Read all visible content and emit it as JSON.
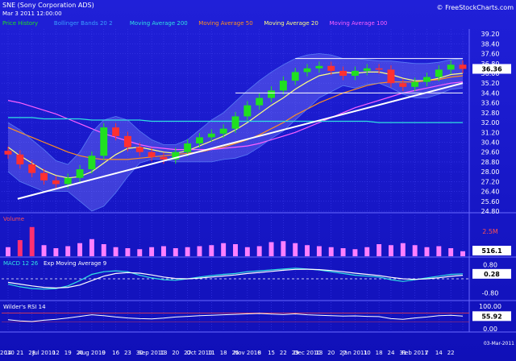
{
  "header": {
    "symbol": "SNE (Sony Corporation ADS)",
    "date": "Mar 3 2011 12:00:00",
    "brand": "© FreeStockCharts.com"
  },
  "legend": [
    {
      "label": "Price History",
      "color": "#20e020"
    },
    {
      "label": "Bollinger Bands 20 2",
      "color": "#3aa0ff"
    },
    {
      "label": "Moving Average 200",
      "color": "#30e0e0"
    },
    {
      "label": "Moving Average 50",
      "color": "#ff9020"
    },
    {
      "label": "Moving Average 20",
      "color": "#ffff80"
    },
    {
      "label": "Moving Average 100",
      "color": "#ff60ff"
    }
  ],
  "chart_data": [
    {
      "type": "line",
      "name": "price",
      "ylim": [
        24.8,
        39.6
      ],
      "yticks": [
        "39.20",
        "38.40",
        "37.60",
        "36.80",
        "36.00",
        "35.20",
        "34.40",
        "33.60",
        "32.80",
        "32.00",
        "31.20",
        "30.40",
        "29.60",
        "28.80",
        "28.00",
        "27.20",
        "26.40",
        "25.60",
        "24.80"
      ],
      "last_value": "36.36",
      "x_dates": [
        "2010-06-14",
        "2010-06-21",
        "2010-06-28",
        "2010-07-06",
        "2010-07-12",
        "2010-07-19",
        "2010-07-26",
        "2010-08-02",
        "2010-08-09",
        "2010-08-16",
        "2010-08-23",
        "2010-08-30",
        "2010-09-07",
        "2010-09-13",
        "2010-09-20",
        "2010-09-27",
        "2010-10-04",
        "2010-10-11",
        "2010-10-18",
        "2010-10-25",
        "2010-11-01",
        "2010-11-08",
        "2010-11-15",
        "2010-11-22",
        "2010-11-29",
        "2010-12-06",
        "2010-12-13",
        "2010-12-20",
        "2010-12-27",
        "2011-01-03",
        "2011-01-10",
        "2011-01-18",
        "2011-01-24",
        "2011-01-31",
        "2011-02-07",
        "2011-02-14",
        "2011-02-22",
        "2011-02-28",
        "2011-03-03"
      ],
      "series": [
        {
          "name": "Price",
          "color": "#20e020",
          "values": [
            29.4,
            28.6,
            27.9,
            27.3,
            27.0,
            27.5,
            28.2,
            29.3,
            31.6,
            30.9,
            30.0,
            29.6,
            29.2,
            29.0,
            29.6,
            30.3,
            30.8,
            31.1,
            31.5,
            32.5,
            33.4,
            34.0,
            34.6,
            35.4,
            36.1,
            36.4,
            36.6,
            36.2,
            35.8,
            36.2,
            36.4,
            36.3,
            35.2,
            34.9,
            35.3,
            35.7,
            36.3,
            36.7,
            36.36
          ]
        },
        {
          "name": "Moving Average 20",
          "color": "#ffff80",
          "values": [
            30.0,
            29.3,
            28.7,
            28.1,
            27.7,
            27.5,
            27.6,
            28.0,
            28.7,
            29.4,
            29.9,
            30.0,
            29.8,
            29.6,
            29.5,
            29.7,
            30.1,
            30.5,
            30.9,
            31.4,
            32.0,
            32.7,
            33.4,
            34.0,
            34.7,
            35.3,
            35.8,
            36.0,
            36.1,
            36.0,
            36.1,
            36.1,
            35.9,
            35.6,
            35.4,
            35.4,
            35.6,
            35.9,
            36.0
          ]
        },
        {
          "name": "Moving Average 50",
          "color": "#ff9020",
          "values": [
            31.6,
            31.2,
            30.8,
            30.4,
            30.0,
            29.6,
            29.3,
            29.1,
            29.0,
            29.0,
            29.0,
            29.1,
            29.2,
            29.3,
            29.4,
            29.5,
            29.6,
            29.8,
            30.0,
            30.3,
            30.6,
            31.0,
            31.5,
            32.0,
            32.6,
            33.1,
            33.6,
            34.0,
            34.4,
            34.7,
            35.0,
            35.2,
            35.3,
            35.3,
            35.3,
            35.4,
            35.5,
            35.7,
            35.8
          ]
        },
        {
          "name": "Moving Average 100",
          "color": "#ff60ff",
          "values": [
            33.8,
            33.6,
            33.3,
            33.0,
            32.7,
            32.3,
            31.9,
            31.5,
            31.1,
            30.8,
            30.5,
            30.2,
            30.0,
            29.9,
            29.8,
            29.8,
            29.8,
            29.8,
            29.9,
            30.0,
            30.1,
            30.3,
            30.6,
            30.9,
            31.2,
            31.6,
            32.0,
            32.4,
            32.8,
            33.2,
            33.5,
            33.8,
            34.1,
            34.4,
            34.6,
            34.8,
            35.0,
            35.2,
            35.3
          ]
        },
        {
          "name": "Moving Average 200",
          "color": "#30e0e0",
          "values": [
            32.4,
            32.4,
            32.4,
            32.3,
            32.3,
            32.3,
            32.3,
            32.2,
            32.2,
            32.2,
            32.2,
            32.2,
            32.1,
            32.1,
            32.1,
            32.1,
            32.1,
            32.1,
            32.1,
            32.1,
            32.1,
            32.1,
            32.1,
            32.1,
            32.1,
            32.1,
            32.1,
            32.1,
            32.1,
            32.1,
            32.1,
            32.0,
            32.0,
            32.0,
            32.0,
            32.0,
            32.0,
            32.0,
            32.0
          ]
        },
        {
          "name": "Bollinger Upper",
          "color": "#6a9aff",
          "values": [
            32.0,
            31.4,
            30.6,
            29.8,
            28.9,
            28.6,
            29.6,
            31.2,
            32.2,
            32.5,
            32.2,
            31.3,
            30.6,
            30.2,
            30.2,
            30.6,
            31.4,
            32.2,
            32.8,
            33.7,
            34.6,
            35.4,
            36.1,
            36.7,
            37.2,
            37.5,
            37.6,
            37.5,
            37.2,
            37.2,
            37.1,
            37.0,
            37.0,
            36.9,
            36.8,
            36.8,
            36.9,
            37.1,
            37.2
          ]
        },
        {
          "name": "Bollinger Lower",
          "color": "#6a9aff",
          "values": [
            28.0,
            27.2,
            26.8,
            26.4,
            26.4,
            26.4,
            25.6,
            24.8,
            25.2,
            26.3,
            27.6,
            28.7,
            29.0,
            29.0,
            28.8,
            28.8,
            28.8,
            28.8,
            29.0,
            29.1,
            29.4,
            30.0,
            30.7,
            31.3,
            32.2,
            33.1,
            34.0,
            34.5,
            35.0,
            34.8,
            35.1,
            35.2,
            34.8,
            34.3,
            34.0,
            34.0,
            34.3,
            34.7,
            34.8
          ]
        }
      ],
      "annotations": [
        "upward trend line",
        "horizontal resistance line",
        "horizontal support line"
      ]
    },
    {
      "type": "bar",
      "name": "Volume",
      "title": "Volume",
      "yticks": [
        "2.5M"
      ],
      "last_value": "516.1",
      "values": [
        0.9,
        1.6,
        2.9,
        1.1,
        0.8,
        1.0,
        1.3,
        1.7,
        1.2,
        0.9,
        0.8,
        0.7,
        0.9,
        1.0,
        0.8,
        0.9,
        1.0,
        1.1,
        1.3,
        1.2,
        0.9,
        1.0,
        1.4,
        1.5,
        1.3,
        1.1,
        1.0,
        0.9,
        0.8,
        0.7,
        0.9,
        1.2,
        1.1,
        1.3,
        1.1,
        0.9,
        1.0,
        0.8,
        0.5
      ]
    },
    {
      "type": "line",
      "name": "MACD",
      "title": "MACD 12 26",
      "subtitle": "Exp Moving Average 9",
      "ylim": [
        -1.0,
        1.0
      ],
      "yticks": [
        "0.80",
        "-0.80"
      ],
      "last_value": "0.28",
      "series": [
        {
          "name": "MACD 12 26",
          "color": "#30e0e0",
          "values": [
            -0.3,
            -0.45,
            -0.55,
            -0.58,
            -0.55,
            -0.4,
            -0.1,
            0.25,
            0.4,
            0.45,
            0.4,
            0.2,
            0.05,
            -0.05,
            -0.08,
            0.0,
            0.1,
            0.18,
            0.25,
            0.3,
            0.4,
            0.45,
            0.5,
            0.55,
            0.6,
            0.55,
            0.5,
            0.4,
            0.3,
            0.2,
            0.15,
            0.1,
            -0.05,
            -0.15,
            -0.05,
            0.05,
            0.15,
            0.25,
            0.28
          ]
        },
        {
          "name": "Exp Moving Average 9",
          "color": "#ffffff",
          "values": [
            -0.2,
            -0.3,
            -0.4,
            -0.48,
            -0.52,
            -0.48,
            -0.35,
            -0.1,
            0.15,
            0.3,
            0.35,
            0.32,
            0.22,
            0.1,
            0.02,
            0.0,
            0.04,
            0.1,
            0.16,
            0.22,
            0.3,
            0.36,
            0.42,
            0.48,
            0.53,
            0.54,
            0.52,
            0.47,
            0.4,
            0.32,
            0.25,
            0.18,
            0.08,
            0.0,
            -0.03,
            0.0,
            0.06,
            0.14,
            0.2
          ]
        }
      ]
    },
    {
      "type": "line",
      "name": "RSI",
      "title": "Wilder's RSI 14",
      "ylim": [
        0,
        100
      ],
      "yticks": [
        "100.00",
        "0.00"
      ],
      "last_value": "55.92",
      "series": [
        {
          "name": "Wilder's RSI 14",
          "color": "#ffffff",
          "values": [
            40,
            35,
            32,
            38,
            42,
            48,
            55,
            62,
            58,
            52,
            48,
            45,
            44,
            47,
            52,
            55,
            58,
            60,
            62,
            64,
            66,
            68,
            65,
            63,
            66,
            62,
            60,
            58,
            56,
            57,
            55,
            54,
            45,
            42,
            48,
            52,
            58,
            60,
            55.92
          ]
        }
      ]
    }
  ],
  "x_axis": {
    "labels": [
      {
        "t": "2010",
        "i": 0
      },
      {
        "t": "14",
        "i": 0
      },
      {
        "t": "21",
        "i": 1
      },
      {
        "t": "28",
        "i": 2
      },
      {
        "t": "Jul 2010",
        "i": 3
      },
      {
        "t": "12",
        "i": 4
      },
      {
        "t": "19",
        "i": 5
      },
      {
        "t": "26",
        "i": 6
      },
      {
        "t": "Aug 2010",
        "i": 7
      },
      {
        "t": "9",
        "i": 8
      },
      {
        "t": "16",
        "i": 9
      },
      {
        "t": "23",
        "i": 10
      },
      {
        "t": "30",
        "i": 11
      },
      {
        "t": "Sep 2010",
        "i": 12
      },
      {
        "t": "13",
        "i": 13
      },
      {
        "t": "20",
        "i": 14
      },
      {
        "t": "27",
        "i": 15
      },
      {
        "t": "Oct 2010",
        "i": 16
      },
      {
        "t": "11",
        "i": 17
      },
      {
        "t": "18",
        "i": 18
      },
      {
        "t": "25",
        "i": 19
      },
      {
        "t": "Nov 2010",
        "i": 20
      },
      {
        "t": "8",
        "i": 21
      },
      {
        "t": "15",
        "i": 22
      },
      {
        "t": "22",
        "i": 23
      },
      {
        "t": "29",
        "i": 24
      },
      {
        "t": "Dec 2010",
        "i": 25
      },
      {
        "t": "13",
        "i": 26
      },
      {
        "t": "20",
        "i": 27
      },
      {
        "t": "27",
        "i": 28
      },
      {
        "t": "Jan 2011",
        "i": 29
      },
      {
        "t": "10",
        "i": 30
      },
      {
        "t": "18",
        "i": 31
      },
      {
        "t": "24",
        "i": 32
      },
      {
        "t": "31",
        "i": 33
      },
      {
        "t": "Feb 2011",
        "i": 34
      },
      {
        "t": "7",
        "i": 35
      },
      {
        "t": "14",
        "i": 36
      },
      {
        "t": "22",
        "i": 37
      },
      {
        "t": "03-Mar-2011",
        "i": 38
      }
    ]
  }
}
